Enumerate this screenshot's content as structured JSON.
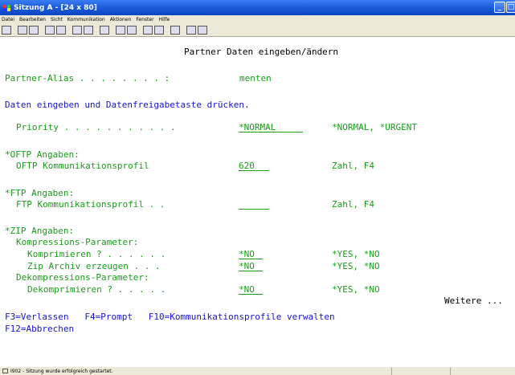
{
  "window": {
    "title": "Sitzung A - [24 x 80]",
    "minimize_glyph": "_",
    "restore_glyph": "□"
  },
  "menu": [
    "Datei",
    "Bearbeiten",
    "Sicht",
    "Kommunikation",
    "Aktionen",
    "Fenster",
    "Hilfe"
  ],
  "screen": {
    "heading": "Partner Daten eingeben/ändern",
    "alias_label": "Partner-Alias . . . . . . . . :",
    "alias_value": "menten",
    "instruction": "Daten eingeben und Datenfreigabetaste drücken.",
    "priority_label": "Priority . . . . . . . . . . .",
    "priority_value": "*NORMAL",
    "priority_hint": "*NORMAL, *URGENT",
    "oftp_section": "*OFTP Angaben:",
    "oftp_label": "OFTP Kommunikationsprofil",
    "oftp_value": "620",
    "oftp_hint": "Zahl, F4",
    "ftp_section": "*FTP Angaben:",
    "ftp_label": "FTP Kommunikationsprofil . .",
    "ftp_value": "",
    "ftp_hint": "Zahl, F4",
    "zip_section": "*ZIP Angaben:",
    "compress_section": "Kompressions-Parameter:",
    "komprimieren_label": "Komprimieren ? . . . . . .",
    "komprimieren_value": "*NO",
    "komprimieren_hint": "*YES, *NO",
    "zip_archiv_label": "Zip Archiv erzeugen . . .",
    "zip_archiv_value": "*NO",
    "zip_archiv_hint": "*YES, *NO",
    "decompress_section": "Dekompressions-Parameter:",
    "dekomprimieren_label": "Dekomprimieren ? . . . . .",
    "dekomprimieren_value": "*NO",
    "dekomprimieren_hint": "*YES, *NO",
    "more": "Weitere ...",
    "fkeys_line1": "F3=Verlassen   F4=Prompt   F10=Kommunikationsprofile verwalten",
    "fkeys_line2": "F12=Abbrechen"
  },
  "status": {
    "message": "I902 - Sitzung wurde erfolgreich gestartet."
  },
  "colors": {
    "field_green": "#1a9c1a",
    "text_blue": "#1414d0",
    "title_blue": "#1858d8"
  }
}
